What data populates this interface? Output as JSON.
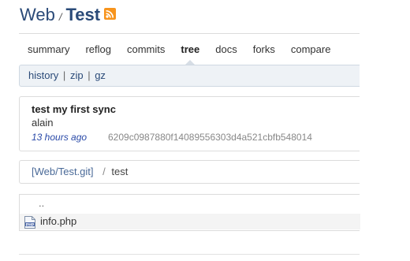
{
  "header": {
    "parent": "Web",
    "separator": "/",
    "repo": "Test",
    "rss_icon": "rss-feed-icon"
  },
  "nav": {
    "items": [
      {
        "label": "summary"
      },
      {
        "label": "reflog"
      },
      {
        "label": "commits"
      },
      {
        "label": "tree"
      },
      {
        "label": "docs"
      },
      {
        "label": "forks"
      },
      {
        "label": "compare"
      }
    ],
    "active": "tree"
  },
  "subnav": {
    "history": "history",
    "zip": "zip",
    "gz": "gz",
    "pipe": "|"
  },
  "commit": {
    "message": "test my first sync",
    "author": "alain",
    "age": "13 hours ago",
    "sha": "6209c0987880f14089556303d4a521cbfb548014"
  },
  "path": {
    "repo_link": "[Web/Test.git]",
    "separator": "/",
    "folder": "test"
  },
  "tree": {
    "parent_label": "..",
    "files": [
      {
        "name": "info.php",
        "icon": "php-file-icon"
      }
    ]
  },
  "colors": {
    "link": "#2a4a78",
    "rss": "#f7941d",
    "age": "#2a4aa8"
  }
}
